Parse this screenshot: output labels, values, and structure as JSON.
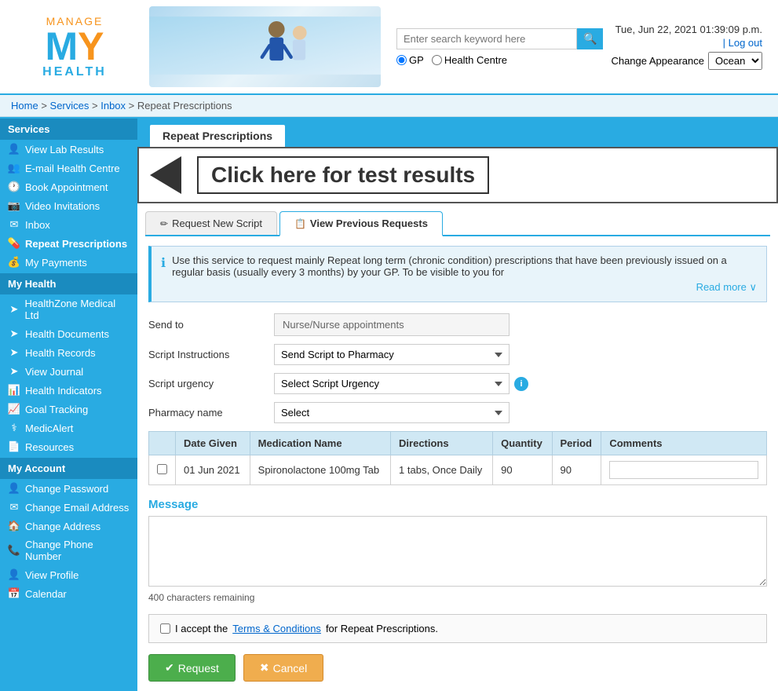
{
  "header": {
    "logo": {
      "manage": "MANAGE",
      "my_m": "M",
      "my_y": "Y",
      "health": "HEALTH"
    },
    "search": {
      "placeholder": "Enter search keyword here",
      "button_label": "🔍"
    },
    "radio": {
      "gp_label": "GP",
      "health_centre_label": "Health Centre"
    },
    "datetime": "Tue, Jun 22, 2021 01:39:09 p.m.",
    "logout_label": "| Log out",
    "appearance_label": "Change Appearance",
    "appearance_value": "Ocean"
  },
  "breadcrumb": {
    "home": "Home",
    "services": "Services",
    "inbox": "Inbox",
    "current": "Repeat Prescriptions"
  },
  "sidebar": {
    "services_title": "Services",
    "services_items": [
      {
        "label": "View Lab Results",
        "icon": "👤"
      },
      {
        "label": "E-mail Health Centre",
        "icon": "👥"
      },
      {
        "label": "Book Appointment",
        "icon": "🕐"
      },
      {
        "label": "Video Invitations",
        "icon": "📷"
      },
      {
        "label": "Inbox",
        "icon": "✉"
      },
      {
        "label": "Repeat Prescriptions",
        "icon": "💊"
      },
      {
        "label": "My Payments",
        "icon": "💰"
      }
    ],
    "myhealth_title": "My Health",
    "myhealth_items": [
      {
        "label": "HealthZone Medical Ltd",
        "icon": "➤"
      },
      {
        "label": "Health Documents",
        "icon": "➤"
      },
      {
        "label": "Health Records",
        "icon": "➤"
      },
      {
        "label": "View Journal",
        "icon": "➤"
      },
      {
        "label": "Health Indicators",
        "icon": "📊"
      },
      {
        "label": "Goal Tracking",
        "icon": "📈"
      },
      {
        "label": "MedicAlert",
        "icon": "⚕"
      },
      {
        "label": "Resources",
        "icon": "📄"
      }
    ],
    "myaccount_title": "My Account",
    "myaccount_items": [
      {
        "label": "Change Password",
        "icon": "👤"
      },
      {
        "label": "Change Email Address",
        "icon": "✉"
      },
      {
        "label": "Change Address",
        "icon": "🏠"
      },
      {
        "label": "Change Phone Number",
        "icon": "📞"
      },
      {
        "label": "View Profile",
        "icon": "👤"
      },
      {
        "label": "Calendar",
        "icon": "📅"
      }
    ]
  },
  "page": {
    "title": "Repeat Prescriptions",
    "callout_text": "Click here for test results",
    "tabs": [
      {
        "label": "Request New Script",
        "icon": "✏",
        "active": false
      },
      {
        "label": "View Previous Requests",
        "icon": "📋",
        "active": true
      }
    ],
    "info_text": "Use this service to request mainly Repeat long term (chronic condition) prescriptions that have been previously issued on a regular basis (usually every 3 months) by your GP. To be visible to you for",
    "read_more": "Read more ∨",
    "form": {
      "send_to_label": "Send to",
      "send_to_value": "Nurse/Nurse appointments",
      "script_instructions_label": "Script Instructions",
      "script_instructions_value": "Send Script to Pharmacy",
      "script_urgency_label": "Script urgency",
      "script_urgency_value": "Select Script Urgency",
      "pharmacy_name_label": "Pharmacy name",
      "pharmacy_name_value": "Select"
    },
    "table": {
      "headers": [
        "",
        "Date Given",
        "Medication Name",
        "Directions",
        "Quantity",
        "Period",
        "Comments"
      ],
      "rows": [
        {
          "checked": false,
          "date_given": "01 Jun 2021",
          "medication_name": "Spironolactone 100mg Tab",
          "directions": "1 tabs, Once Daily",
          "quantity": "90",
          "period": "90",
          "comments": ""
        }
      ]
    },
    "message_label": "Message",
    "char_remaining": "400 characters remaining",
    "terms_prefix": "I accept the ",
    "terms_link": "Terms & Conditions",
    "terms_suffix": " for Repeat Prescriptions.",
    "request_button": "Request",
    "cancel_button": "Cancel"
  }
}
